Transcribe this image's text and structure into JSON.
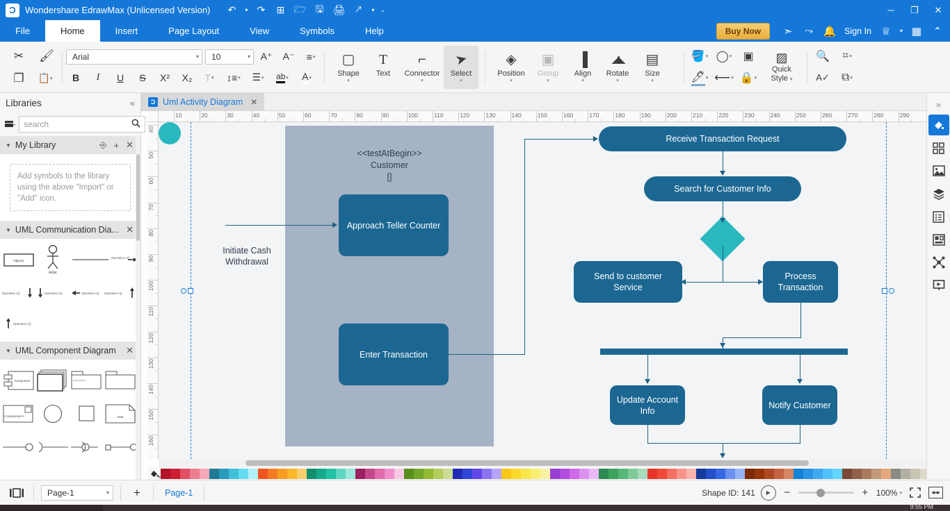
{
  "window": {
    "title": "Wondershare EdrawMax (Unlicensed Version)",
    "logo_glyph": "Ɔ",
    "quick_access": [
      {
        "name": "undo-icon",
        "glyph": "↶"
      },
      {
        "name": "undo-dropdown-icon",
        "glyph": "▾"
      },
      {
        "name": "redo-icon",
        "glyph": "↷"
      },
      {
        "name": "new-icon",
        "glyph": "⊞"
      },
      {
        "name": "open-icon",
        "glyph": "🗁"
      },
      {
        "name": "save-icon",
        "glyph": "🖫"
      },
      {
        "name": "print-icon",
        "glyph": "🖨"
      },
      {
        "name": "export-icon",
        "glyph": "🡕"
      },
      {
        "name": "export-dropdown-icon",
        "glyph": "▾"
      },
      {
        "name": "customize-qat-icon",
        "glyph": "⌄"
      }
    ],
    "controls": [
      {
        "name": "minimize-button",
        "glyph": "─"
      },
      {
        "name": "maximize-button",
        "glyph": "❐"
      },
      {
        "name": "close-button",
        "glyph": "✕"
      }
    ]
  },
  "menubar": {
    "items": [
      "File",
      "Home",
      "Insert",
      "Page Layout",
      "View",
      "Symbols",
      "Help"
    ],
    "active": "Home",
    "buy_now": "Buy Now",
    "sign_in": "Sign In",
    "right_icons": [
      {
        "name": "send-feedback-icon",
        "glyph": "➣"
      },
      {
        "name": "share-icon",
        "glyph": "⤳"
      },
      {
        "name": "notification-bell-icon",
        "glyph": "🔔"
      }
    ],
    "theme_icon": "♕",
    "theme_dropdown": "▾",
    "apps_grid_icon": "▦",
    "collapse_ribbon_icon": "⌃"
  },
  "ribbon": {
    "clipboard": [
      {
        "name": "cut-icon",
        "glyph": "✂"
      },
      {
        "name": "format-painter-icon",
        "glyph": "🖌"
      },
      {
        "name": "copy-icon",
        "glyph": "❐"
      },
      {
        "name": "paste-icon",
        "glyph": "📋"
      },
      {
        "name": "paste-dropdown-icon",
        "glyph": "▾"
      }
    ],
    "font_family": "Arial",
    "font_size": "10",
    "font_controls_row1": [
      {
        "name": "increase-font-size-button",
        "glyph": "A⁺"
      },
      {
        "name": "decrease-font-size-button",
        "glyph": "A⁻"
      },
      {
        "name": "paragraph-align-button",
        "glyph": "≡"
      }
    ],
    "font_controls_row2": [
      {
        "name": "bold-button",
        "glyph": "B"
      },
      {
        "name": "italic-button",
        "glyph": "I"
      },
      {
        "name": "underline-button",
        "glyph": "U"
      },
      {
        "name": "strikethrough-button",
        "glyph": "S"
      },
      {
        "name": "superscript-button",
        "glyph": "X²"
      },
      {
        "name": "subscript-button",
        "glyph": "X₂"
      },
      {
        "name": "text-effect-button",
        "glyph": "T"
      },
      {
        "name": "line-spacing-button",
        "glyph": "↕≡"
      },
      {
        "name": "bullet-list-button",
        "glyph": "☰"
      },
      {
        "name": "text-highlight-button",
        "glyph": "ab"
      },
      {
        "name": "font-color-button",
        "glyph": "A"
      }
    ],
    "tools": [
      {
        "name": "shape-tool",
        "label": "Shape",
        "glyph": "▢",
        "caret": true,
        "state": "normal"
      },
      {
        "name": "text-tool",
        "label": "Text",
        "glyph": "T",
        "caret": false,
        "state": "normal"
      },
      {
        "name": "connector-tool",
        "label": "Connector",
        "glyph": "⌐",
        "caret": true,
        "state": "normal"
      },
      {
        "name": "select-tool",
        "label": "Select",
        "glyph": "➤",
        "caret": true,
        "state": "active"
      }
    ],
    "arrange": [
      {
        "name": "position-tool",
        "label": "Position",
        "glyph": "◈",
        "caret": true,
        "state": "normal"
      },
      {
        "name": "group-tool",
        "label": "Group",
        "glyph": "▣",
        "caret": true,
        "state": "disabled"
      },
      {
        "name": "align-tool",
        "label": "Align",
        "glyph": "▐",
        "caret": true,
        "state": "normal"
      },
      {
        "name": "rotate-tool",
        "label": "Rotate",
        "glyph": "◢◣",
        "caret": true,
        "state": "normal"
      },
      {
        "name": "size-tool",
        "label": "Size",
        "glyph": "▤",
        "caret": true,
        "state": "normal"
      }
    ],
    "style_row1": [
      {
        "name": "fill-color-button",
        "glyph": "🪣",
        "caret": true
      },
      {
        "name": "shadow-button",
        "glyph": "◯",
        "caret": true
      },
      {
        "name": "shape-effect-button",
        "glyph": "▣",
        "caret": false
      }
    ],
    "style_row2": [
      {
        "name": "line-color-button",
        "glyph": "🖊",
        "caret": true
      },
      {
        "name": "line-style-button",
        "glyph": "⟵",
        "caret": true
      },
      {
        "name": "lock-button",
        "glyph": "🔒",
        "caret": true
      }
    ],
    "quick_style_label_1": "Quick",
    "quick_style_label_2": "Style",
    "extras_row1": [
      {
        "name": "find-replace-button",
        "glyph": "🔍",
        "caret": false
      },
      {
        "name": "crop-button",
        "glyph": "⌗",
        "caret": true
      }
    ],
    "extras_row2": [
      {
        "name": "spell-check-button",
        "glyph": "A✓",
        "caret": false
      },
      {
        "name": "replace-shape-button",
        "glyph": "⧉",
        "caret": true
      }
    ]
  },
  "libraries": {
    "panel_title": "Libraries",
    "collapse_icon": "«",
    "library_menu_icon": "🗃",
    "search_placeholder": "search",
    "search_value": "",
    "search_icon": "🔍",
    "nav_up_icon": "⌃",
    "nav_down_icon": "⌄",
    "sections": [
      {
        "name": "My Library",
        "title": "My Library",
        "empty_text": "Add symbols to the library using the above \"Import\" or \"Add\" icon.",
        "actions": [
          "import-icon",
          "add-icon",
          "close-icon"
        ]
      },
      {
        "name": "UML Communication Dia...",
        "title": "UML Communication Dia...",
        "actions": [
          "close-icon"
        ],
        "shape_labels": [
          "Object1",
          "Actor",
          "Operation A()",
          "Operation A()",
          "Operation A()",
          "Operation A()",
          "Operation A()",
          "Operation A()"
        ]
      },
      {
        "name": "UML Component Diagram",
        "title": "UML Component Diagram",
        "actions": [
          "close-icon"
        ],
        "shape_labels": [
          "Component",
          "",
          "",
          "",
          "<<component>>",
          "",
          "",
          "Note"
        ]
      }
    ]
  },
  "document_tab": {
    "label": "Uml Activity Diagram",
    "icon": "Ɔ",
    "close_icon": "✕"
  },
  "rulers": {
    "horizontal_ticks": [
      10,
      20,
      30,
      40,
      50,
      60,
      70,
      80,
      90,
      100,
      110,
      120,
      130,
      140,
      150,
      160,
      170,
      180,
      190,
      200,
      210,
      220,
      230,
      240,
      250,
      260,
      270,
      280,
      290
    ],
    "vertical_ticks": [
      40,
      50,
      60,
      70,
      80,
      90,
      100,
      110,
      120,
      130,
      140,
      150,
      160
    ]
  },
  "diagram": {
    "swimlane": {
      "stereotype": "<<testAtBegin>>",
      "name": "Customer",
      "brackets": "[]"
    },
    "start": {
      "label_line1": "Initiate Cash",
      "label_line2": "Withdrawal"
    },
    "nodes": [
      {
        "id": "approach-teller-counter",
        "label": "Approach Teller Counter"
      },
      {
        "id": "enter-transaction",
        "label": "Enter Transaction"
      },
      {
        "id": "receive-transaction-request",
        "label": "Receive Transaction Request"
      },
      {
        "id": "search-for-customer-info",
        "label": "Search for Customer Info"
      },
      {
        "id": "send-to-customer-service",
        "label": "Send to customer Service"
      },
      {
        "id": "process-transaction",
        "label": "Process Transaction"
      },
      {
        "id": "update-account-info",
        "label": "Update Account Info"
      },
      {
        "id": "notify-customer",
        "label": "Notify Customer"
      }
    ],
    "colors": {
      "node_fill": "#1b6792",
      "accent": "#2ab8bf",
      "lane_fill": "#a6b3c4",
      "connector": "#1f6184",
      "canvas_bg": "#f2f4f5"
    }
  },
  "right_rail": {
    "collapse_icon": "»",
    "items": [
      {
        "name": "fill-style-panel-icon",
        "glyph": "◈",
        "active": true
      },
      {
        "name": "shape-library-panel-icon",
        "glyph": "▚",
        "active": false
      },
      {
        "name": "image-panel-icon",
        "glyph": "🖼",
        "active": false
      },
      {
        "name": "layers-panel-icon",
        "glyph": "❖",
        "active": false
      },
      {
        "name": "notes-panel-icon",
        "glyph": "📋",
        "active": false
      },
      {
        "name": "infographic-panel-icon",
        "glyph": "▦",
        "active": false
      },
      {
        "name": "mindmap-panel-icon",
        "glyph": "✥",
        "active": false
      },
      {
        "name": "presentation-panel-icon",
        "glyph": "📽",
        "active": false
      }
    ]
  },
  "palette": {
    "fill_icon": "🪣",
    "fill_dropdown": "▾",
    "colors": [
      "#b3132a",
      "#cc1f33",
      "#e14f63",
      "#ef7d91",
      "#f5a8b6",
      "#1f7a96",
      "#2a9bbd",
      "#3fc0d8",
      "#63dcef",
      "#b4f0f8",
      "#f2551f",
      "#f57b22",
      "#f99c23",
      "#fab72a",
      "#f8cd6b",
      "#0e8f6e",
      "#16a98b",
      "#23c2a6",
      "#5fd6c2",
      "#9de8da",
      "#9e2060",
      "#c24a8c",
      "#e06bab",
      "#f18ecb",
      "#f8c9e4",
      "#5a8f1e",
      "#74a62a",
      "#93bb31",
      "#b3cd5e",
      "#ccdc95",
      "#1f2bb5",
      "#2f45d6",
      "#6447ea",
      "#8d73f2",
      "#b5a4f7",
      "#f9c718",
      "#fada2b",
      "#f9e64a",
      "#f9ee76",
      "#f9f2a3",
      "#9a3fd4",
      "#b34ce0",
      "#cf6ae8",
      "#dd92f0",
      "#e9b8f6",
      "#2b8a4f",
      "#3ea35f",
      "#56b878",
      "#7ecb98",
      "#a8dbbb",
      "#e8352b",
      "#f04a38",
      "#f47062",
      "#f7958a",
      "#f9b5ad",
      "#16399c",
      "#2450c9",
      "#3668e6",
      "#6a90f0",
      "#97b4f5",
      "#7c2a06",
      "#96340a",
      "#ad4a23",
      "#c46344",
      "#d68562",
      "#1383d8",
      "#2a95e5",
      "#3fa9f0",
      "#4fc2fa",
      "#63d5ff",
      "#7a4a35",
      "#91604a",
      "#a87a5e",
      "#c2997b",
      "#e5a87c",
      "#8b8b85",
      "#b3b0a3",
      "#c8c5b5",
      "#ded9c8",
      "#efece0",
      "#151515",
      "#2f2f2f",
      "#454545",
      "#5a5a5a",
      "#6f6f6f"
    ]
  },
  "statusbar": {
    "view_icon": "◫",
    "page_select_value": "Page-1",
    "page_select_arrow": "▾",
    "add_page_icon": "+",
    "page_tag": "Page-1",
    "shape_id_label": "Shape ID: 141",
    "present_icon": "▶",
    "zoom_out": "−",
    "zoom_in": "+",
    "zoom_level": "100%",
    "zoom_dropdown": "▾",
    "fullscreen_icon": "⛶",
    "fit_width_icon": "↔"
  },
  "taskbar": {
    "clock": "9:55 PM"
  }
}
